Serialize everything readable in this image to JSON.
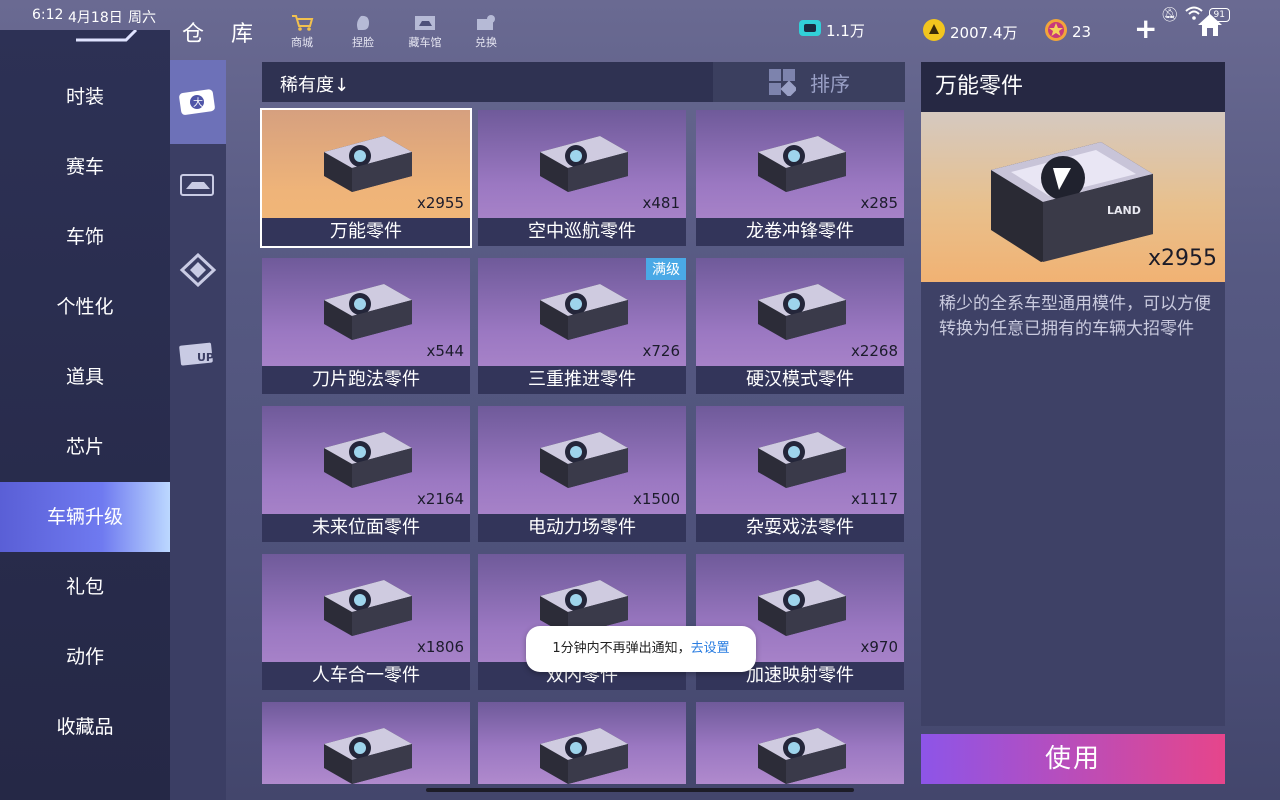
{
  "status_bar": {
    "time": "6:12",
    "date": "4月18日",
    "weekday": "周六",
    "battery": "91"
  },
  "header": {
    "title": "仓 库",
    "buttons": [
      {
        "label": "商城",
        "icon": "cart-icon"
      },
      {
        "label": "捏脸",
        "icon": "face-icon"
      },
      {
        "label": "藏车馆",
        "icon": "garage-icon"
      },
      {
        "label": "兑换",
        "icon": "exchange-icon"
      }
    ],
    "currencies": [
      {
        "value": "1.1万",
        "icon": "ticket-icon"
      },
      {
        "value": "2007.4万",
        "icon": "coin-icon"
      },
      {
        "value": "23",
        "icon": "star-coin-icon"
      }
    ],
    "plus": "+"
  },
  "left_nav": {
    "items": [
      "时装",
      "赛车",
      "车饰",
      "个性化",
      "道具",
      "芯片",
      "车辆升级",
      "礼包",
      "动作",
      "收藏品"
    ],
    "active": "车辆升级"
  },
  "sort_bar": {
    "rarity_label": "稀有度↓",
    "sort_label": "排序"
  },
  "items": [
    {
      "name": "万能零件",
      "qty": "x2955"
    },
    {
      "name": "空中巡航零件",
      "qty": "x481"
    },
    {
      "name": "龙卷冲锋零件",
      "qty": "x285"
    },
    {
      "name": "刀片跑法零件",
      "qty": "x544"
    },
    {
      "name": "三重推进零件",
      "qty": "x726",
      "badge": "满级"
    },
    {
      "name": "硬汉模式零件",
      "qty": "x2268"
    },
    {
      "name": "未来位面零件",
      "qty": "x2164"
    },
    {
      "name": "电动力场零件",
      "qty": "x1500"
    },
    {
      "name": "杂耍戏法零件",
      "qty": "x1117"
    },
    {
      "name": "人车合一零件",
      "qty": "x1806"
    },
    {
      "name": "双闪零件",
      "qty": ""
    },
    {
      "name": "加速映射零件",
      "qty": "x970"
    },
    {
      "name": "",
      "qty": ""
    },
    {
      "name": "",
      "qty": ""
    },
    {
      "name": "",
      "qty": ""
    }
  ],
  "detail": {
    "title": "万能零件",
    "qty": "x2955",
    "description": "稀少的全系车型通用模件，可以方便转换为任意已拥有的车辆大招零件",
    "box_text": "LAND"
  },
  "use_button": "使用",
  "toast": {
    "text": "1分钟内不再弹出通知，",
    "link": "去设置"
  },
  "colors": {
    "accent": "#6f7af0",
    "use_start": "#8d55e8",
    "use_end": "#e6458b",
    "badge": "#4aa9e6"
  }
}
